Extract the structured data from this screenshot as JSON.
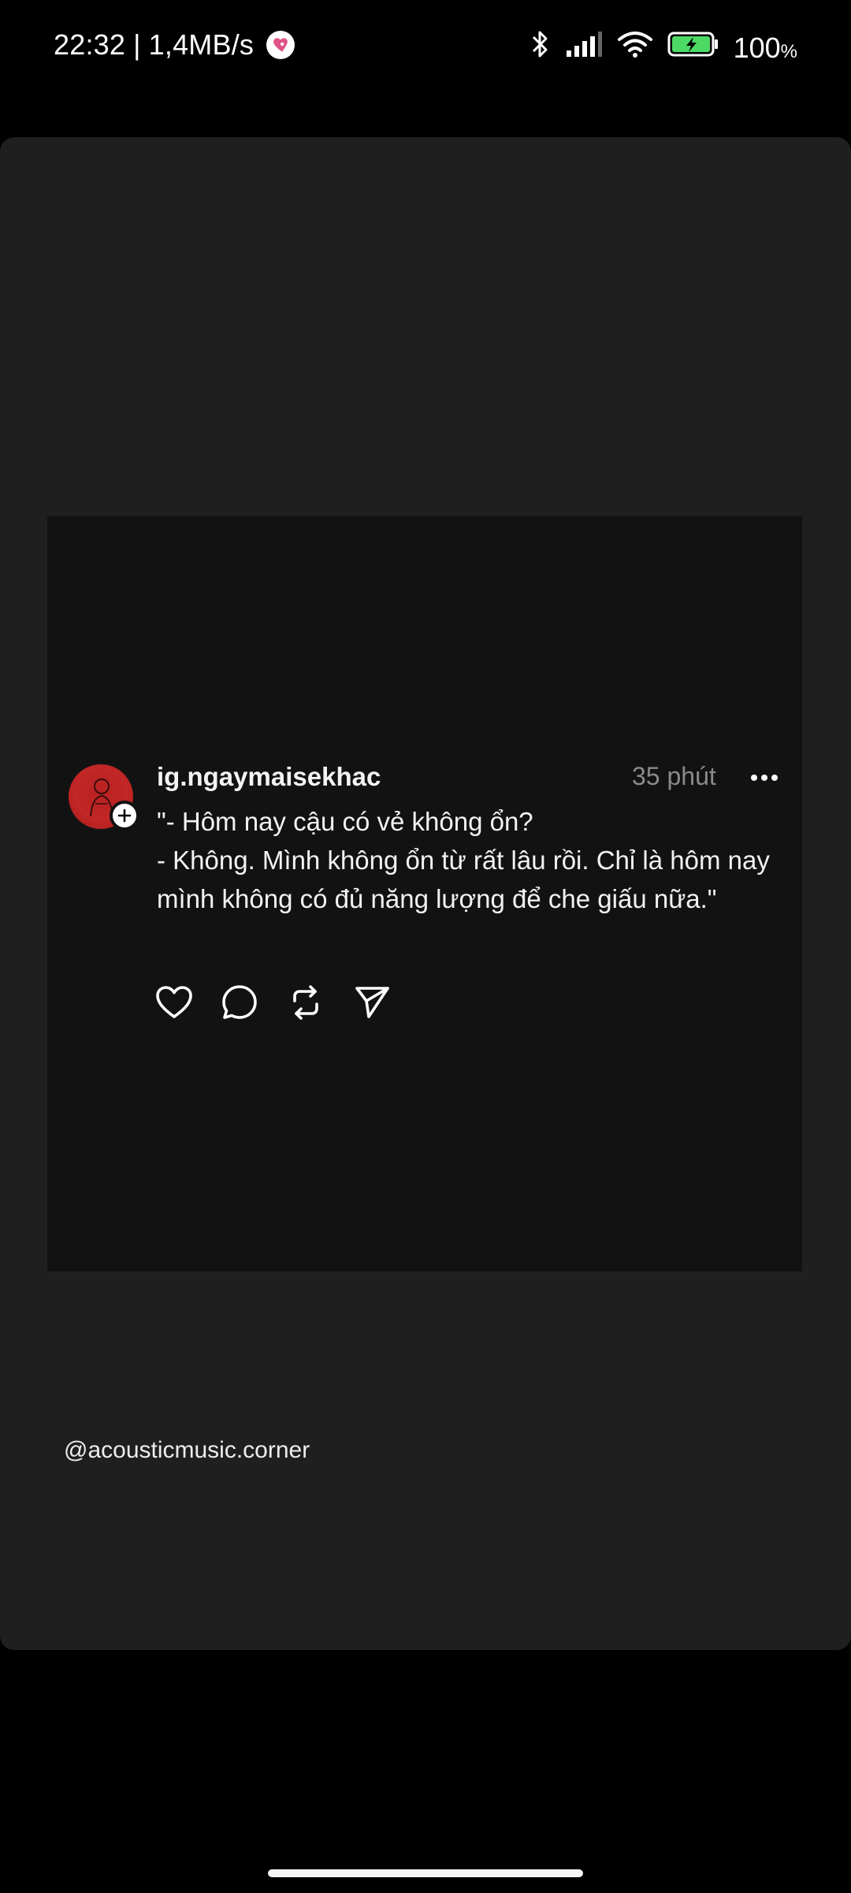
{
  "status_bar": {
    "time": "22:32",
    "separator": "|",
    "network_speed": "1,4MB/s",
    "battery_percent": "100",
    "battery_unit": "%",
    "icons": [
      "heart-badge-icon",
      "bluetooth-icon",
      "signal-icon",
      "wifi-icon",
      "battery-charging-icon"
    ]
  },
  "post": {
    "username": "ig.ngaymaisekhac",
    "time_ago": "35 phút",
    "lines": [
      "\"- Hôm nay cậu có vẻ không ổn?",
      "- Không. Mình không ổn từ rất lâu rồi. Chỉ là hôm nay mình không có đủ năng lượng để che giấu nữa.\""
    ],
    "actions": [
      "heart-icon",
      "comment-icon",
      "repost-icon",
      "share-icon"
    ]
  },
  "watermark": "@acousticmusic.corner",
  "colors": {
    "background": "#000000",
    "sheet": "#1f1f1f",
    "card": "#121212",
    "avatar": "#c22626",
    "time_text": "#8a8a8a",
    "battery": "#4cd964"
  }
}
